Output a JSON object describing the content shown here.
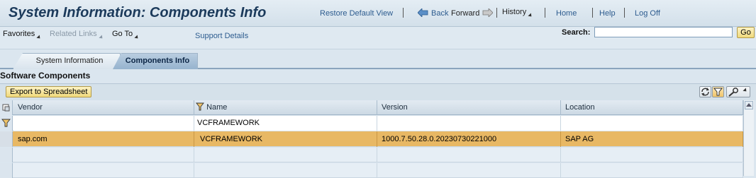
{
  "header": {
    "page_title": "System Information: Components Info",
    "restore_default_view": "Restore Default View",
    "back": "Back",
    "forward": "Forward",
    "history": "History",
    "home": "Home",
    "help": "Help",
    "log_off": "Log Off"
  },
  "menubar": {
    "favorites": "Favorites",
    "related_links": "Related Links",
    "go_to": "Go To",
    "support_details": "Support Details",
    "search_label": "Search:",
    "search_value": "",
    "go_label": "Go"
  },
  "tabs": [
    {
      "label": "System Information",
      "active": false
    },
    {
      "label": "Components Info",
      "active": true
    }
  ],
  "section": {
    "title": "Software Components",
    "export_label": "Export to Spreadsheet"
  },
  "table": {
    "columns": [
      "Vendor",
      "Name",
      "Version",
      "Location"
    ],
    "filter_values": [
      "",
      "VCFRAMEWORK",
      "",
      ""
    ],
    "rows": [
      [
        "sap.com",
        "VCFRAMEWORK",
        "1000.7.50.28.0.20230730221000",
        "SAP AG"
      ]
    ]
  },
  "icons": [
    "back-arrow-icon",
    "forward-arrow-icon",
    "refresh-icon",
    "filter-icon",
    "settings-icon",
    "column-select-icon",
    "filter-row-icon",
    "scroll-up-icon"
  ],
  "colors": {
    "selected_row": "#e8b864",
    "active_tab": "#96b3ce",
    "title": "#1b3a5b",
    "link": "#2d5c8f"
  }
}
